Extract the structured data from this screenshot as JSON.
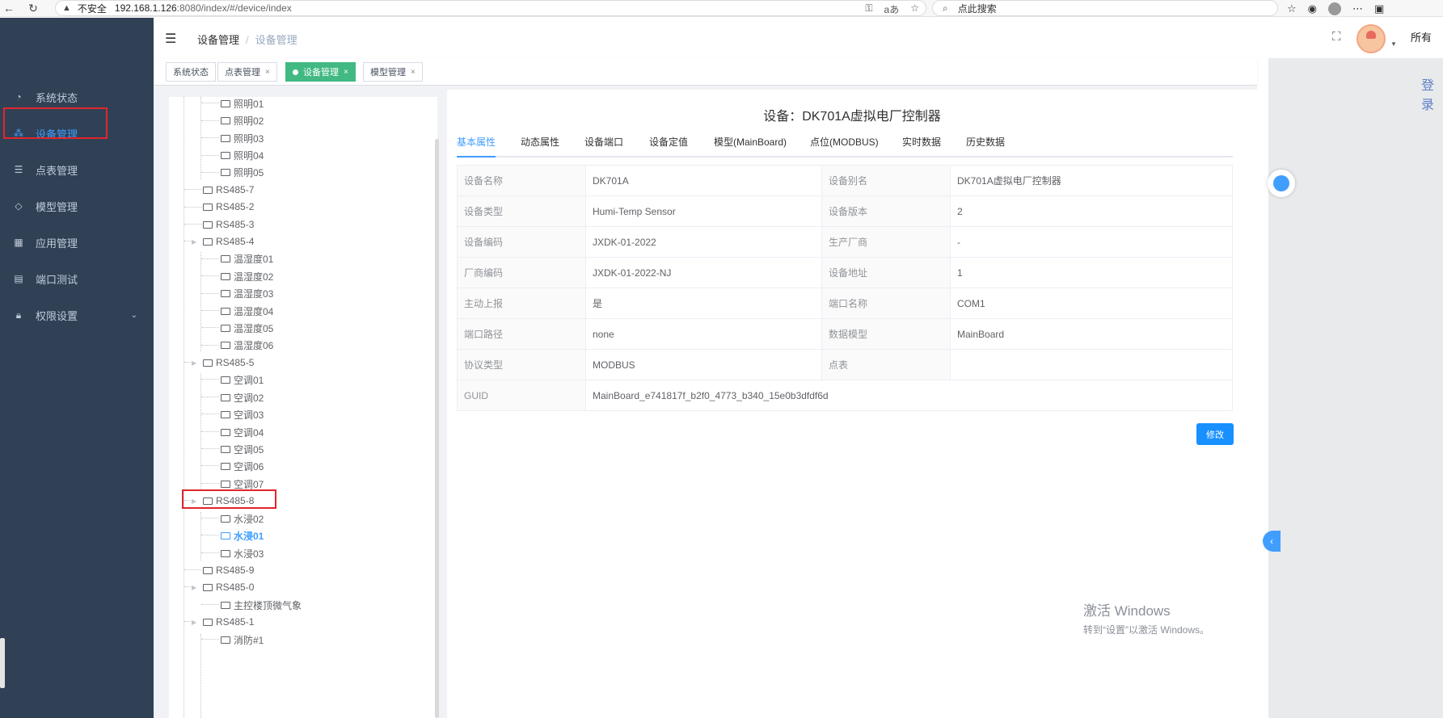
{
  "browser": {
    "not_secure": "不安全",
    "url_host": "192.168.1.126",
    "url_rest": ":8080/index/#/device/index",
    "search_placeholder": "点此搜索"
  },
  "sidebar": {
    "items": [
      {
        "label": "系统状态",
        "icon": "dashboard-icon"
      },
      {
        "label": "设备管理",
        "icon": "sitemap-icon"
      },
      {
        "label": "点表管理",
        "icon": "list-icon"
      },
      {
        "label": "模型管理",
        "icon": "cube-icon"
      },
      {
        "label": "应用管理",
        "icon": "apps-icon"
      },
      {
        "label": "端口测试",
        "icon": "port-icon"
      },
      {
        "label": "权限设置",
        "icon": "lock-icon"
      }
    ]
  },
  "header": {
    "breadcrumb_1": "设备管理",
    "breadcrumb_sep": "/",
    "breadcrumb_2": "设备管理",
    "side_cut": "所有"
  },
  "tags": [
    {
      "label": "系统状态"
    },
    {
      "label": "点表管理"
    },
    {
      "label": "设备管理"
    },
    {
      "label": "模型管理"
    }
  ],
  "tree": [
    {
      "label": "照明01"
    },
    {
      "label": "照明02"
    },
    {
      "label": "照明03"
    },
    {
      "label": "照明04"
    },
    {
      "label": "照明05"
    },
    {
      "label": "RS485-7"
    },
    {
      "label": "RS485-2"
    },
    {
      "label": "RS485-3"
    },
    {
      "label": "RS485-4"
    },
    {
      "label": "温湿度01"
    },
    {
      "label": "温湿度02"
    },
    {
      "label": "温湿度03"
    },
    {
      "label": "温湿度04"
    },
    {
      "label": "温湿度05"
    },
    {
      "label": "温湿度06"
    },
    {
      "label": "RS485-5"
    },
    {
      "label": "空调01"
    },
    {
      "label": "空调02"
    },
    {
      "label": "空调03"
    },
    {
      "label": "空调04"
    },
    {
      "label": "空调05"
    },
    {
      "label": "空调06"
    },
    {
      "label": "空调07"
    },
    {
      "label": "RS485-8"
    },
    {
      "label": "水浸02"
    },
    {
      "label": "水浸01"
    },
    {
      "label": "水浸03"
    },
    {
      "label": "RS485-9"
    },
    {
      "label": "RS485-0"
    },
    {
      "label": "主控楼顶微气象"
    },
    {
      "label": "RS485-1"
    },
    {
      "label": "消防#1"
    }
  ],
  "detail": {
    "title": "设备：DK701A虚拟电厂控制器",
    "tabs": [
      "基本属性",
      "动态属性",
      "设备端口",
      "设备定值",
      "模型(MainBoard)",
      "点位(MODBUS)",
      "实时数据",
      "历史数据"
    ],
    "rows": [
      {
        "l1": "设备名称",
        "v1": "DK701A",
        "l2": "设备别名",
        "v2": "DK701A虚拟电厂控制器"
      },
      {
        "l1": "设备类型",
        "v1": "Humi-Temp Sensor",
        "l2": "设备版本",
        "v2": "2"
      },
      {
        "l1": "设备编码",
        "v1": "JXDK-01-2022",
        "l2": "生产厂商",
        "v2": "-"
      },
      {
        "l1": "厂商编码",
        "v1": "JXDK-01-2022-NJ",
        "l2": "设备地址",
        "v2": "1"
      },
      {
        "l1": "主动上报",
        "v1": "是",
        "l2": "端口名称",
        "v2": "COM1"
      },
      {
        "l1": "端口路径",
        "v1": "none",
        "l2": "数据模型",
        "v2": "MainBoard"
      },
      {
        "l1": "协议类型",
        "v1": "MODBUS",
        "l2": "点表",
        "v2": ""
      }
    ],
    "guid_label": "GUID",
    "guid_value": "MainBoard_e741817f_b2f0_4773_b340_15e0b3dfdf6d",
    "edit_label": "修改"
  },
  "overlay": {
    "login_cut": "登录",
    "watermark_1": "激活 Windows",
    "watermark_2": "转到“设置”以激活 Windows。"
  },
  "colors": {
    "sidebar_bg": "#304156",
    "sidebar_active": "#409eff",
    "tag_active": "#42b983",
    "primary": "#1890ff",
    "highlight_box": "#e0262c"
  }
}
